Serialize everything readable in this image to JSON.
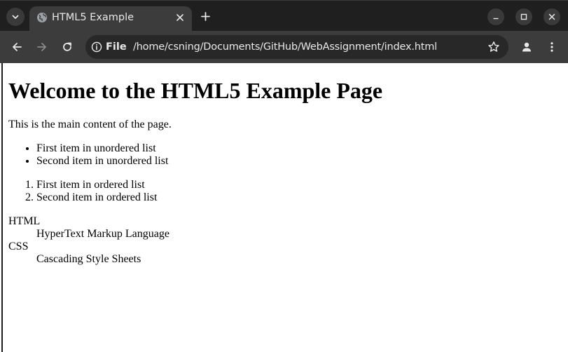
{
  "browser": {
    "tab": {
      "title": "HTML5 Example"
    },
    "toolbar": {
      "site_info_label": "File",
      "url": "/home/csning/Documents/GitHub/WebAssignment/index.html"
    }
  },
  "page": {
    "heading": "Welcome to the HTML5 Example Page",
    "paragraph": "This is the main content of the page.",
    "unordered_list": [
      "First item in unordered list",
      "Second item in unordered list"
    ],
    "ordered_list": [
      "First item in ordered list",
      "Second item in ordered list"
    ],
    "definitions": [
      {
        "term": "HTML",
        "description": "HyperText Markup Language"
      },
      {
        "term": "CSS",
        "description": "Cascading Style Sheets"
      }
    ]
  },
  "icons": {
    "tab_search": "chevron-down-icon",
    "favicon": "globe-icon",
    "tab_close": "close-icon",
    "new_tab": "plus-icon",
    "minimize": "minimize-icon",
    "maximize": "maximize-icon",
    "close_window": "close-icon",
    "back": "back-arrow-icon",
    "forward": "forward-arrow-icon",
    "reload": "reload-icon",
    "site_info": "info-icon",
    "bookmark": "star-icon",
    "profile": "person-icon",
    "menu": "kebab-menu-icon"
  },
  "colors": {
    "tabstrip_bg": "#1f1f1f",
    "toolbar_bg": "#3c3c3c",
    "omnibox_bg": "#282828",
    "text_light": "#e8e8e8",
    "page_bg": "#ffffff"
  }
}
